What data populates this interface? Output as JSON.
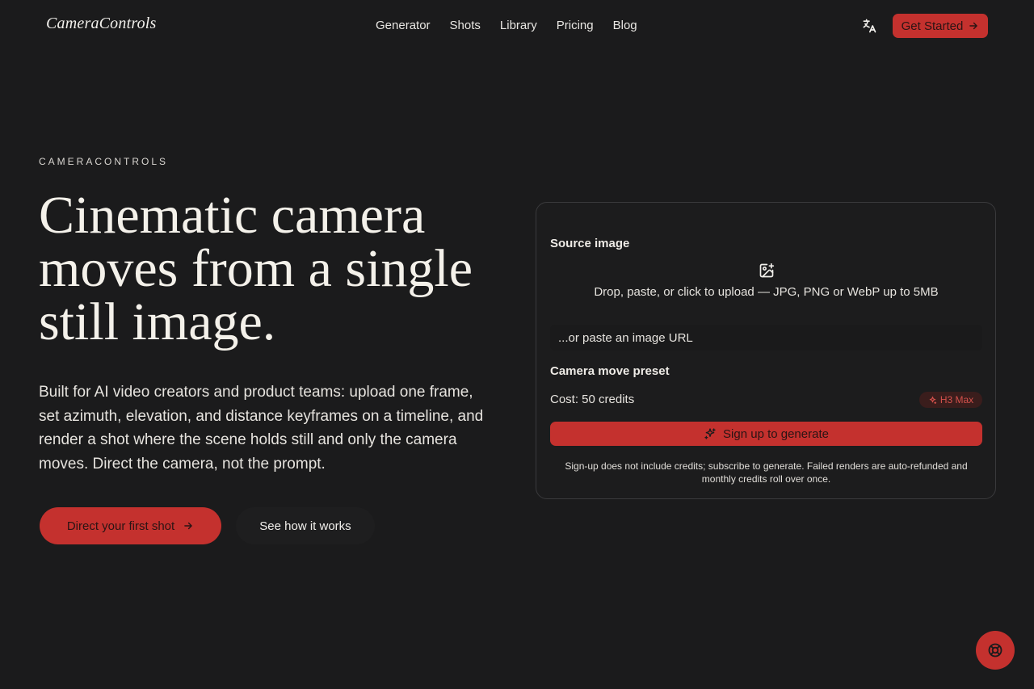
{
  "header": {
    "logo": "CameraControls",
    "nav": [
      "Generator",
      "Shots",
      "Library",
      "Pricing",
      "Blog"
    ],
    "translate_icon": "translate-icon",
    "get_started": "Get Started"
  },
  "hero": {
    "eyebrow": "CAMERACONTROLS",
    "headline": "Cinematic camera moves from a single still image.",
    "subcopy": "Built for AI video creators and product teams: upload one frame, set azimuth, elevation, and distance keyframes on a timeline, and render a shot where the scene holds still and only the camera moves. Direct the camera, not the prompt.",
    "cta_primary": "Direct your first shot",
    "cta_secondary": "See how it works"
  },
  "card": {
    "source_label": "Source image",
    "drop_text": "Drop, paste, or click to upload — JPG, PNG or WebP up to 5MB",
    "url_placeholder": "...or paste an image URL",
    "preset_label": "Camera move preset",
    "cost": "Cost: 50 credits",
    "badge": "H3 Max",
    "generate": "Sign up to generate",
    "fineprint": "Sign-up does not include credits; subscribe to generate. Failed renders are auto-refunded and monthly credits roll over once."
  },
  "colors": {
    "background": "#1b1b1c",
    "accent": "#c4312e",
    "text": "#f2f0ec"
  }
}
